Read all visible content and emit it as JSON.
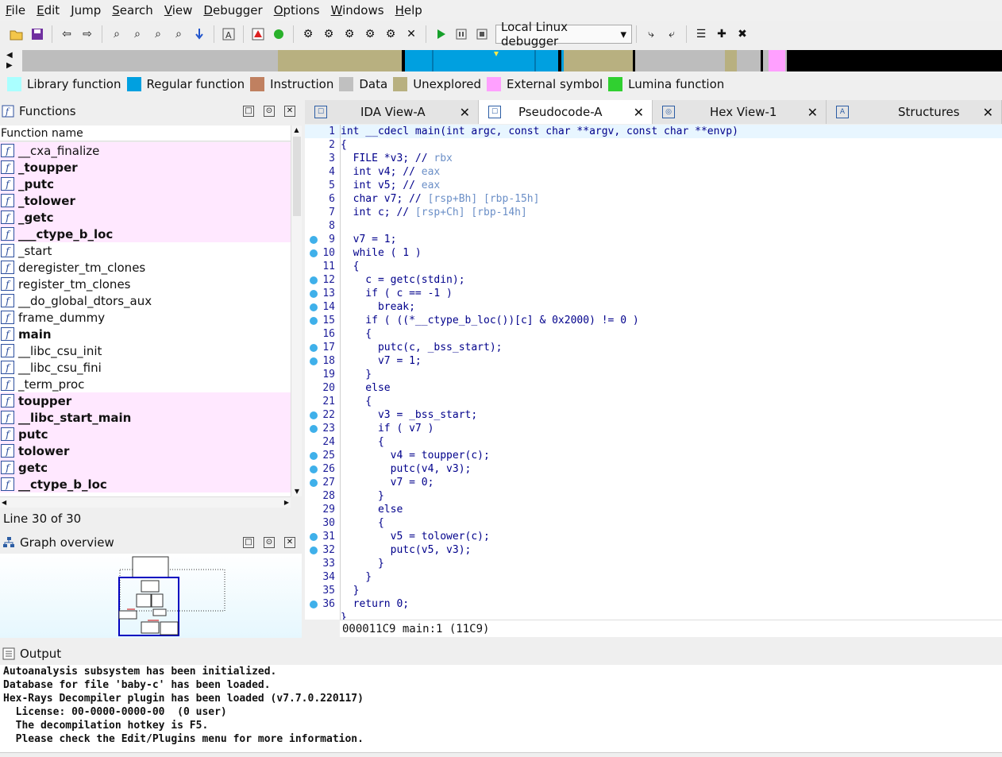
{
  "menu": [
    "File",
    "Edit",
    "Jump",
    "Search",
    "View",
    "Debugger",
    "Options",
    "Windows",
    "Help"
  ],
  "menu_underline": [
    "F",
    "E",
    "J",
    "S",
    "V",
    "D",
    "O",
    "W",
    "H"
  ],
  "toolbar": {
    "debugger_select": "Local Linux debugger"
  },
  "legend": [
    {
      "label": "Library function",
      "color": "#aaffff"
    },
    {
      "label": "Regular function",
      "color": "#00a0e0"
    },
    {
      "label": "Instruction",
      "color": "#c08060"
    },
    {
      "label": "Data",
      "color": "#c0c0c0"
    },
    {
      "label": "Unexplored",
      "color": "#b8b080"
    },
    {
      "label": "External symbol",
      "color": "#ffa0ff"
    },
    {
      "label": "Lumina function",
      "color": "#30d030"
    }
  ],
  "functions_panel": {
    "title": "Functions",
    "header": "Function name",
    "items": [
      {
        "name": "__cxa_finalize",
        "lib": true,
        "bold": false
      },
      {
        "name": "_toupper",
        "lib": true,
        "bold": true
      },
      {
        "name": "_putc",
        "lib": true,
        "bold": true
      },
      {
        "name": "_tolower",
        "lib": true,
        "bold": true
      },
      {
        "name": "_getc",
        "lib": true,
        "bold": true
      },
      {
        "name": "___ctype_b_loc",
        "lib": true,
        "bold": true
      },
      {
        "name": "_start",
        "lib": false,
        "bold": false
      },
      {
        "name": "deregister_tm_clones",
        "lib": false,
        "bold": false
      },
      {
        "name": "register_tm_clones",
        "lib": false,
        "bold": false
      },
      {
        "name": "__do_global_dtors_aux",
        "lib": false,
        "bold": false
      },
      {
        "name": "frame_dummy",
        "lib": false,
        "bold": false
      },
      {
        "name": "main",
        "lib": false,
        "bold": true
      },
      {
        "name": "__libc_csu_init",
        "lib": false,
        "bold": false
      },
      {
        "name": "__libc_csu_fini",
        "lib": false,
        "bold": false
      },
      {
        "name": "_term_proc",
        "lib": false,
        "bold": false
      },
      {
        "name": "toupper",
        "lib": true,
        "bold": true
      },
      {
        "name": "__libc_start_main",
        "lib": true,
        "bold": true
      },
      {
        "name": "putc",
        "lib": true,
        "bold": true
      },
      {
        "name": "tolower",
        "lib": true,
        "bold": true
      },
      {
        "name": "getc",
        "lib": true,
        "bold": true
      },
      {
        "name": "__ctype_b_loc",
        "lib": true,
        "bold": true
      }
    ],
    "status": "Line 30 of 30"
  },
  "graph_panel": {
    "title": "Graph overview"
  },
  "tabs": [
    {
      "label": "IDA View-A",
      "active": false
    },
    {
      "label": "Pseudocode-A",
      "active": true
    },
    {
      "label": "Hex View-1",
      "active": false
    },
    {
      "label": "Structures",
      "active": false
    }
  ],
  "code": [
    {
      "n": "1",
      "bp": false,
      "t": "int __cdecl main(int argc, const char **argv, const char **envp)"
    },
    {
      "n": "2",
      "bp": false,
      "t": "{"
    },
    {
      "n": "3",
      "bp": false,
      "t": "  FILE *v3; // rbx"
    },
    {
      "n": "4",
      "bp": false,
      "t": "  int v4; // eax"
    },
    {
      "n": "5",
      "bp": false,
      "t": "  int v5; // eax"
    },
    {
      "n": "6",
      "bp": false,
      "t": "  char v7; // [rsp+Bh] [rbp-15h]"
    },
    {
      "n": "7",
      "bp": false,
      "t": "  int c; // [rsp+Ch] [rbp-14h]"
    },
    {
      "n": "8",
      "bp": false,
      "t": ""
    },
    {
      "n": "9",
      "bp": true,
      "t": "  v7 = 1;"
    },
    {
      "n": "10",
      "bp": true,
      "t": "  while ( 1 )"
    },
    {
      "n": "11",
      "bp": false,
      "t": "  {"
    },
    {
      "n": "12",
      "bp": true,
      "t": "    c = getc(stdin);"
    },
    {
      "n": "13",
      "bp": true,
      "t": "    if ( c == -1 )"
    },
    {
      "n": "14",
      "bp": true,
      "t": "      break;"
    },
    {
      "n": "15",
      "bp": true,
      "t": "    if ( ((*__ctype_b_loc())[c] & 0x2000) != 0 )"
    },
    {
      "n": "16",
      "bp": false,
      "t": "    {"
    },
    {
      "n": "17",
      "bp": true,
      "t": "      putc(c, _bss_start);"
    },
    {
      "n": "18",
      "bp": true,
      "t": "      v7 = 1;"
    },
    {
      "n": "19",
      "bp": false,
      "t": "    }"
    },
    {
      "n": "20",
      "bp": false,
      "t": "    else"
    },
    {
      "n": "21",
      "bp": false,
      "t": "    {"
    },
    {
      "n": "22",
      "bp": true,
      "t": "      v3 = _bss_start;"
    },
    {
      "n": "23",
      "bp": true,
      "t": "      if ( v7 )"
    },
    {
      "n": "24",
      "bp": false,
      "t": "      {"
    },
    {
      "n": "25",
      "bp": true,
      "t": "        v4 = toupper(c);"
    },
    {
      "n": "26",
      "bp": true,
      "t": "        putc(v4, v3);"
    },
    {
      "n": "27",
      "bp": true,
      "t": "        v7 = 0;"
    },
    {
      "n": "28",
      "bp": false,
      "t": "      }"
    },
    {
      "n": "29",
      "bp": false,
      "t": "      else"
    },
    {
      "n": "30",
      "bp": false,
      "t": "      {"
    },
    {
      "n": "31",
      "bp": true,
      "t": "        v5 = tolower(c);"
    },
    {
      "n": "32",
      "bp": true,
      "t": "        putc(v5, v3);"
    },
    {
      "n": "33",
      "bp": false,
      "t": "      }"
    },
    {
      "n": "34",
      "bp": false,
      "t": "    }"
    },
    {
      "n": "35",
      "bp": false,
      "t": "  }"
    },
    {
      "n": "36",
      "bp": true,
      "t": "  return 0;"
    },
    {
      "n": "",
      "bp": false,
      "t": "}"
    }
  ],
  "code_status": "000011C9 main:1 (11C9)",
  "output": {
    "title": "Output",
    "lines": [
      "Autoanalysis subsystem has been initialized.",
      "Database for file 'baby-c' has been loaded.",
      "Hex-Rays Decompiler plugin has been loaded (v7.7.0.220117)",
      "  License: 00-0000-0000-00  (0 user)",
      "  The decompilation hotkey is F5.",
      "  Please check the Edit/Plugins menu for more information."
    ]
  }
}
